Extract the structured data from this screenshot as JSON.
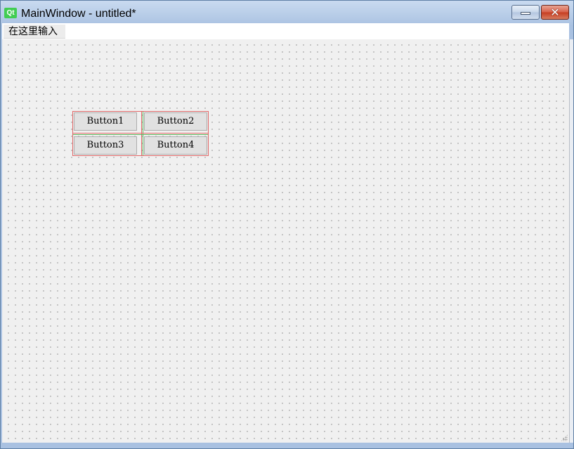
{
  "window": {
    "title": "MainWindow - untitled*",
    "logo_text": "Qt",
    "minimize_glyph": "",
    "close_glyph": "✕"
  },
  "menubar": {
    "items": [
      {
        "label": "在这里输入"
      }
    ]
  },
  "layout": {
    "buttons": [
      {
        "label": "Button1"
      },
      {
        "label": "Button2"
      },
      {
        "label": "Button3"
      },
      {
        "label": "Button4"
      }
    ]
  },
  "colors": {
    "layout_border": "#e06666",
    "layout_guide": "#5bb55b",
    "canvas": "#f0f0f0",
    "close_button": "#c63d22"
  },
  "icons": {
    "app_icon": "qt-logo-icon",
    "minimize": "minimize-icon",
    "close": "close-icon",
    "size_grip": "size-grip-icon"
  }
}
